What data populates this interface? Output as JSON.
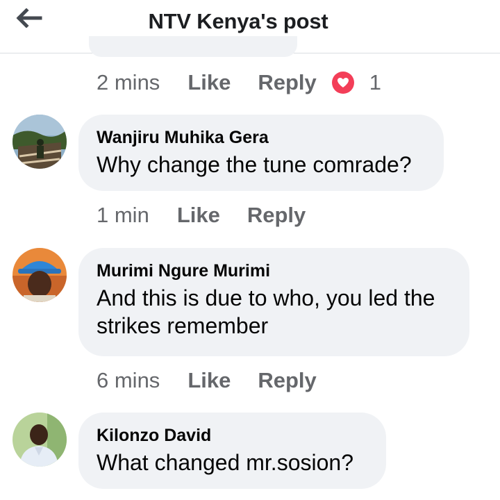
{
  "header": {
    "back_icon": "arrow-left-icon",
    "title": "NTV Kenya's post"
  },
  "top_comment_actions": {
    "time": "2 mins",
    "like": "Like",
    "reply": "Reply",
    "reaction_icon": "heart-reaction-icon",
    "reaction_color": "#f33e58",
    "reaction_count": "1"
  },
  "comments": [
    {
      "author": "Wanjiru Muhika Gera",
      "text": "Why change the tune comrade?",
      "time": "1 min",
      "like": "Like",
      "reply": "Reply"
    },
    {
      "author": "Murimi Ngure Murimi",
      "text": "And this is due to who, you led the strikes remember",
      "time": "6 mins",
      "like": "Like",
      "reply": "Reply"
    },
    {
      "author": "Kilonzo David",
      "text": "What changed mr.sosion?"
    }
  ],
  "colors": {
    "bubble_bg": "#f0f2f5",
    "meta_text": "#65676b",
    "divider": "#dadde1"
  }
}
